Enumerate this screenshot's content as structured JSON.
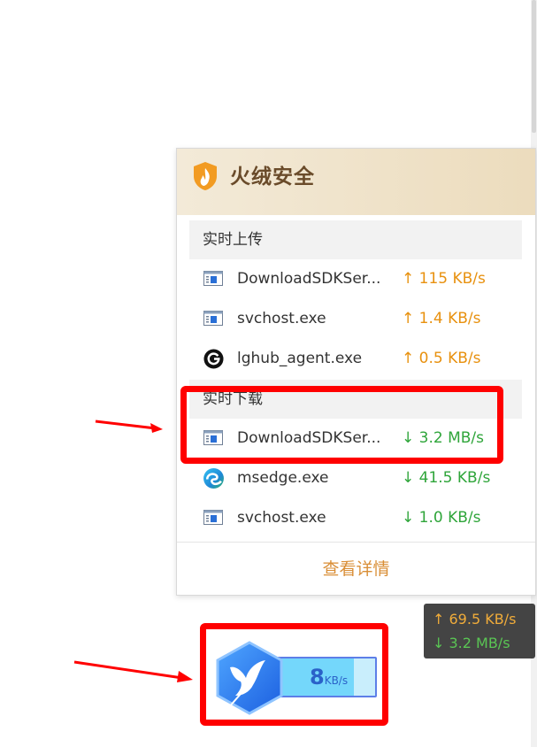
{
  "popup": {
    "brand_title": "火绒安全",
    "upload_header": "实时上传",
    "download_header": "实时下载",
    "uploads": [
      {
        "name": "DownloadSDKSer...",
        "speed": "↑ 115 KB/s",
        "icon": "window-app-icon"
      },
      {
        "name": "svchost.exe",
        "speed": "↑ 1.4 KB/s",
        "icon": "window-app-icon"
      },
      {
        "name": "lghub_agent.exe",
        "speed": "↑ 0.5 KB/s",
        "icon": "logitech-g-icon"
      }
    ],
    "downloads": [
      {
        "name": "DownloadSDKSer...",
        "speed": "↓ 3.2 MB/s",
        "icon": "window-app-icon"
      },
      {
        "name": "msedge.exe",
        "speed": "↓ 41.5 KB/s",
        "icon": "edge-browser-icon"
      },
      {
        "name": "svchost.exe",
        "speed": "↓ 1.0 KB/s",
        "icon": "window-app-icon"
      }
    ],
    "details_link": "查看详情"
  },
  "monitor": {
    "upload": "↑ 69.5 KB/s",
    "download": "↓ 3.2 MB/s"
  },
  "float_ball": {
    "speed_value": "8",
    "speed_unit": "KB/s",
    "icon": "xunlei-bird-icon"
  },
  "colors": {
    "upload": "#e8910f",
    "download": "#2fa53a",
    "highlight": "#ff0000",
    "link": "#d98e36"
  }
}
